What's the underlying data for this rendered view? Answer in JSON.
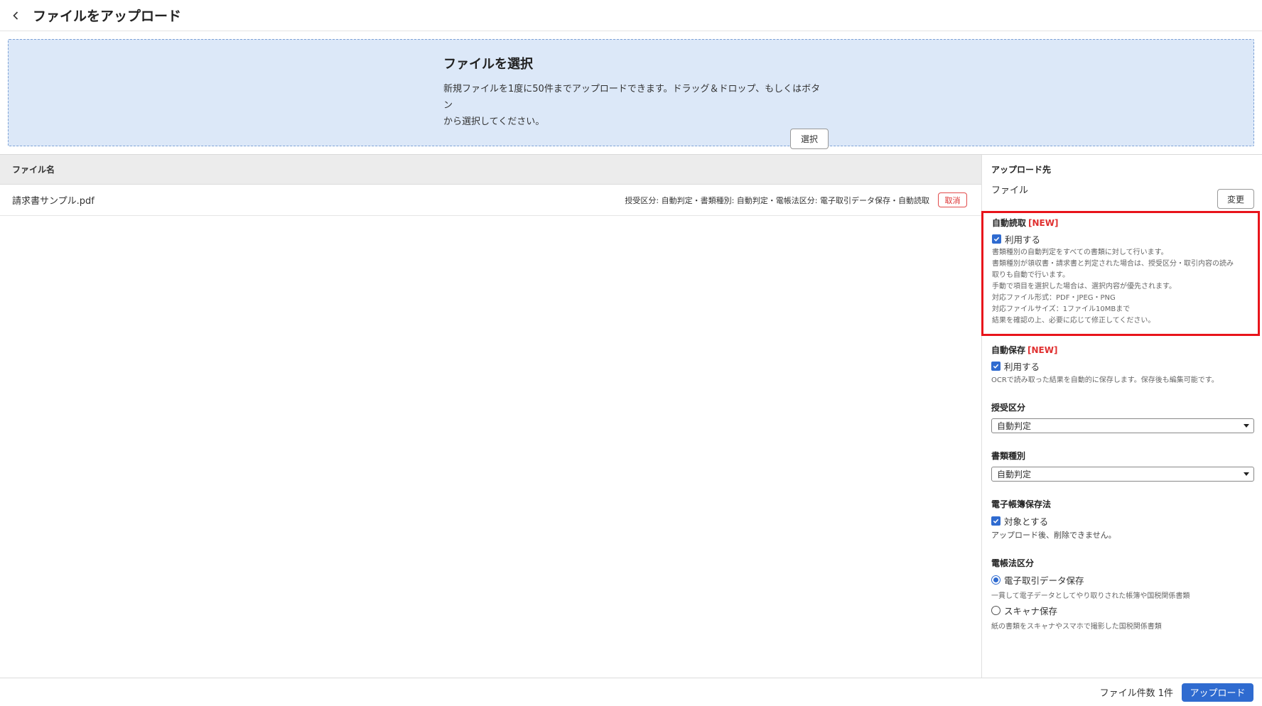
{
  "header": {
    "title": "ファイルをアップロード"
  },
  "dropzone": {
    "title": "ファイルを選択",
    "description_line1": "新規ファイルを1度に50件までアップロードできます。ドラッグ＆ドロップ、もしくはボタン",
    "description_line2": "から選択してください。",
    "select_label": "選択"
  },
  "table": {
    "column_filename": "ファイル名",
    "rows": [
      {
        "name": "請求書サンプル.pdf",
        "meta": "授受区分: 自動判定・書類種別: 自動判定・電帳法区分: 電子取引データ保存・自動読取",
        "cancel_label": "取消"
      }
    ]
  },
  "side": {
    "destination": {
      "label": "アップロード先",
      "value": "ファイル",
      "change_label": "変更"
    },
    "auto_read": {
      "label": "自動読取",
      "badge": "[NEW]",
      "checkbox_label": "利用する",
      "checked": true,
      "notes": [
        "書類種別の自動判定をすべての書類に対して行います。",
        "書類種別が領収書・請求書と判定された場合は、授受区分・取引内容の読み",
        "取りも自動で行います。",
        "手動で項目を選択した場合は、選択内容が優先されます。",
        "対応ファイル形式：PDF・JPEG・PNG",
        "対応ファイルサイズ：1ファイル10MBまで",
        "結果を確認の上、必要に応じて修正してください。"
      ]
    },
    "auto_save": {
      "label": "自動保存",
      "badge": "[NEW]",
      "checkbox_label": "利用する",
      "checked": true,
      "note": "OCRで読み取った結果を自動的に保存します。保存後も編集可能です。"
    },
    "receive_category": {
      "label": "授受区分",
      "selected": "自動判定"
    },
    "document_type": {
      "label": "書類種別",
      "selected": "自動判定"
    },
    "ebook_law": {
      "label": "電子帳簿保存法",
      "checkbox_label": "対象とする",
      "checked": true,
      "note": "アップロード後、削除できません。"
    },
    "ebook_category": {
      "label": "電帳法区分",
      "options": [
        {
          "label": "電子取引データ保存",
          "note": "一貫して電子データとしてやり取りされた帳簿や国税関係書類",
          "selected": true
        },
        {
          "label": "スキャナ保存",
          "note": "紙の書類をスキャナやスマホで撮影した国税関係書類",
          "selected": false
        }
      ]
    }
  },
  "footer": {
    "file_count": "ファイル件数 1件",
    "upload_label": "アップロード"
  },
  "colors": {
    "accent": "#2f6bd0",
    "highlight_border": "#e8141b",
    "badge": "#e03030",
    "dropzone_bg": "#dce8f8"
  }
}
